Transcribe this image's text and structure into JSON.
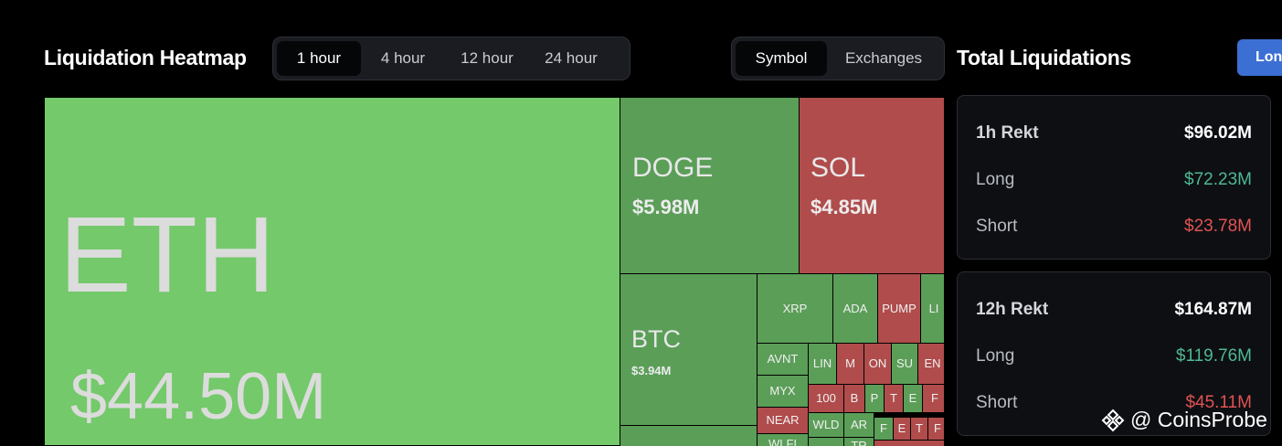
{
  "header": {
    "title": "Liquidation Heatmap",
    "time_tabs": [
      "1 hour",
      "4 hour",
      "12 hour",
      "24 hour"
    ],
    "active_time_tab": "1 hour",
    "view_tabs": [
      "Symbol",
      "Exchanges"
    ],
    "active_view_tab": "Symbol"
  },
  "totals": {
    "title": "Total Liquidations",
    "long_tab_label": "Lon",
    "cards": [
      {
        "head_label": "1h Rekt",
        "head_value": "$96.02M",
        "long_label": "Long",
        "long_value": "$72.23M",
        "short_label": "Short",
        "short_value": "$23.78M"
      },
      {
        "head_label": "12h Rekt",
        "head_value": "$164.87M",
        "long_label": "Long",
        "long_value": "$119.76M",
        "short_label": "Short",
        "short_value": "$45.11M"
      }
    ]
  },
  "heatmap": {
    "eth": {
      "symbol": "ETH",
      "value": "$44.50M"
    },
    "doge": {
      "symbol": "DOGE",
      "value": "$5.98M"
    },
    "sol": {
      "symbol": "SOL",
      "value": "$4.85M"
    },
    "btc": {
      "symbol": "BTC",
      "value": "$3.94M"
    },
    "small": [
      "XRP",
      "ADA",
      "PUMP",
      "LI",
      "AVNT",
      "LIN",
      "M",
      "ON",
      "SU",
      "EN",
      "MYX",
      "100",
      "B",
      "P",
      "T",
      "E",
      "F",
      "NEAR",
      "WLD",
      "AR",
      "F",
      "E",
      "T",
      "F",
      "WLFI",
      "TR"
    ]
  },
  "colors": {
    "long": "#5b9e58",
    "short": "#b04c4c",
    "accent": "#3b6fd4"
  },
  "watermark": "@ CoinsProbe"
}
